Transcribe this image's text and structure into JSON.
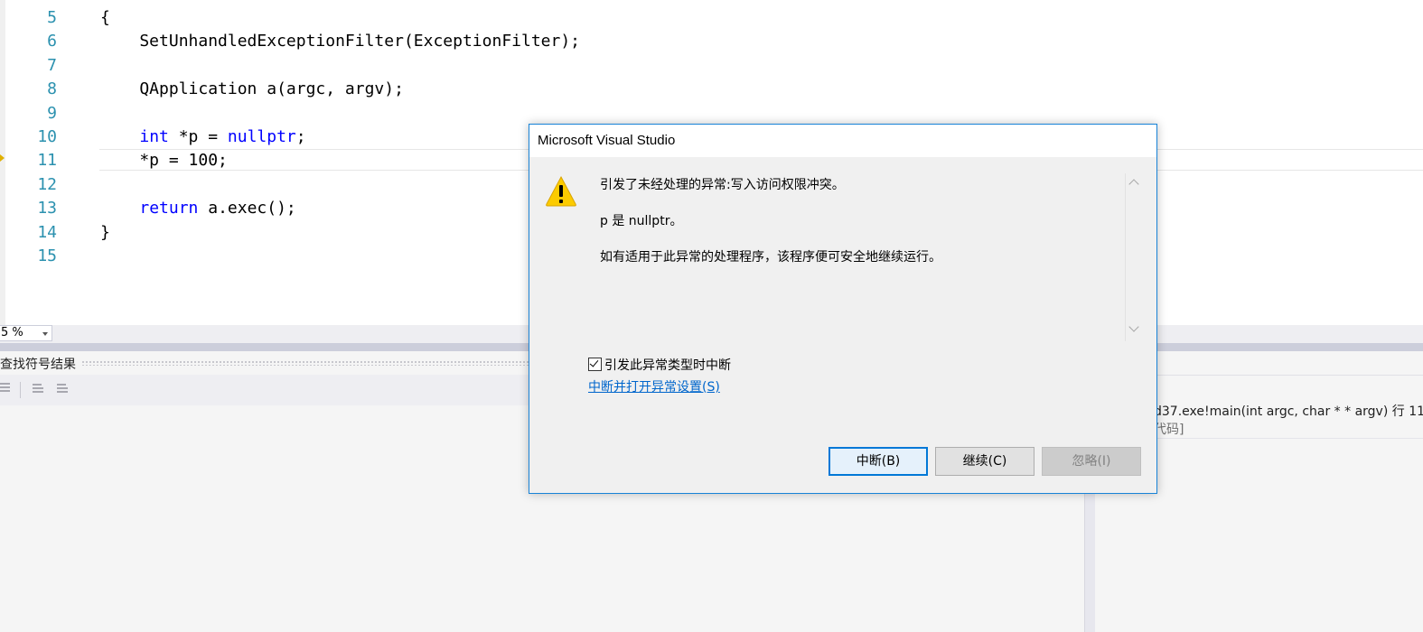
{
  "editor": {
    "lines": [
      {
        "num": "5",
        "tokens": [
          {
            "t": "{"
          }
        ]
      },
      {
        "num": "6",
        "tokens": [
          {
            "t": "    SetUnhandledExceptionFilter(ExceptionFilter);"
          }
        ]
      },
      {
        "num": "7",
        "tokens": []
      },
      {
        "num": "8",
        "tokens": [
          {
            "t": "    QApplication a(argc, argv);"
          }
        ]
      },
      {
        "num": "9",
        "tokens": []
      },
      {
        "num": "10",
        "tokens": [
          {
            "t": "    "
          },
          {
            "t": "int",
            "kw": true
          },
          {
            "t": " *p = "
          },
          {
            "t": "nullptr",
            "kw": true
          },
          {
            "t": ";"
          }
        ]
      },
      {
        "num": "11",
        "tokens": [
          {
            "t": "    *p = 100;"
          }
        ]
      },
      {
        "num": "12",
        "tokens": []
      },
      {
        "num": "13",
        "tokens": [
          {
            "t": "    "
          },
          {
            "t": "return",
            "kw": true
          },
          {
            "t": " a.exec();"
          }
        ]
      },
      {
        "num": "14",
        "tokens": [
          {
            "t": "}"
          }
        ]
      },
      {
        "num": "15",
        "tokens": []
      }
    ]
  },
  "zoom": {
    "value": "5 %"
  },
  "find_panel": {
    "title": "查找符号结果"
  },
  "call_stack": {
    "row1": "d37.exe!main(int argc, char * * argv) 行 11",
    "row2": "代码]"
  },
  "dialog": {
    "title": "Microsoft Visual Studio",
    "message_line1": "引发了未经处理的异常:写入访问权限冲突。",
    "message_line2": "p 是 nullptr。",
    "message_line3": "如有适用于此异常的处理程序，该程序便可安全地继续运行。",
    "checkbox_label": "引发此异常类型时中断",
    "checkbox_checked": true,
    "link_text": "中断并打开异常设置(S)",
    "buttons": {
      "break": "中断(B)",
      "continue": "继续(C)",
      "ignore": "忽略(I)"
    }
  },
  "colors": {
    "keyword": "#0000ff",
    "line_number": "#2b91af",
    "dialog_border": "#1883d7",
    "link": "#0066cc"
  }
}
